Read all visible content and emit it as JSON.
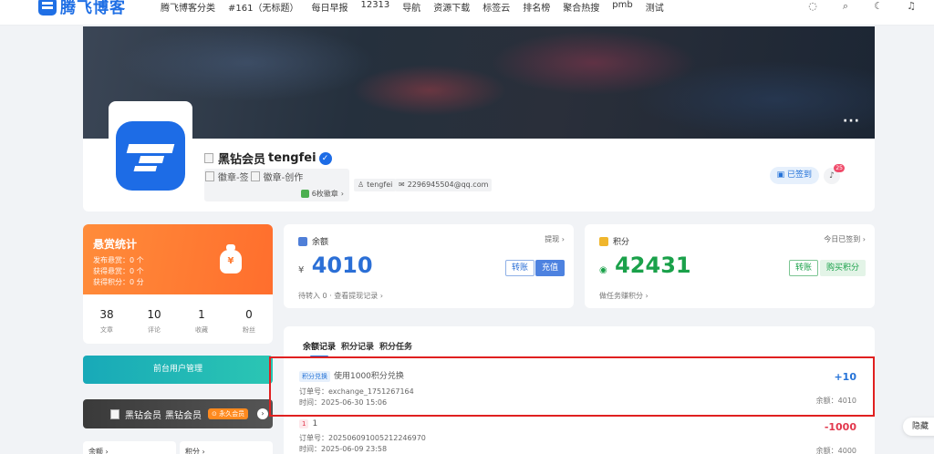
{
  "topbar": {
    "logo_text": "腾飞博客",
    "nav": [
      "腾飞博客分类",
      "#161（无标题）",
      "每日早报",
      "12313",
      "导航",
      "资源下载",
      "标签云",
      "排名榜",
      "聚合热搜",
      "pmb",
      "测试"
    ]
  },
  "profile": {
    "vip_label": "黑钻会员",
    "username": "tengfei",
    "badge_alt_1": "徽章-签",
    "badge_alt_2": "徽章-创作",
    "badge_count": "6枚徽章",
    "chip_user": "tengfei",
    "chip_email": "2296945504@qq.com",
    "checked_in": "已签到",
    "bell_count": "25"
  },
  "bounty": {
    "title": "悬赏统计",
    "line1": "发布悬赏：0 个",
    "line2": "获得悬赏：0 个",
    "line3": "获得积分：0 分",
    "bag_symbol": "¥"
  },
  "stats": [
    {
      "value": "38",
      "label": "文章"
    },
    {
      "value": "10",
      "label": "评论"
    },
    {
      "value": "1",
      "label": "收藏"
    },
    {
      "value": "0",
      "label": "粉丝"
    }
  ],
  "left": {
    "admin_button": "前台用户管理",
    "vip_card_label": "黑钻会员",
    "vip_card_text": "黑钻会员",
    "vip_tag": "永久会员",
    "mini_balance": "余额",
    "mini_points": "积分"
  },
  "balance_card": {
    "title": "余额",
    "link": "提现",
    "currency": "¥",
    "amount": "4010",
    "btn_transfer": "转账",
    "btn_recharge": "充值",
    "sub": "待转入 0 · 查看提现记录"
  },
  "points_card": {
    "title": "积分",
    "link": "今日已签到",
    "amount": "42431",
    "btn_transfer": "转账",
    "btn_buy": "购买积分",
    "sub": "做任务赚积分"
  },
  "records": {
    "tabs": [
      "余额记录",
      "积分记录",
      "积分任务"
    ],
    "items": [
      {
        "tag": "积分兑换",
        "desc": "使用1000积分兑换",
        "order": "订单号：exchange_1751267164",
        "time": "时间：2025-06-30 15:06",
        "amount": "+10",
        "balance": "余额：4010"
      },
      {
        "tag": "1",
        "desc": "1",
        "order": "订单号：202506091005212246970",
        "time": "时间：2025-06-09 23:58",
        "amount": "-1000",
        "balance": "余额：4000"
      }
    ]
  },
  "hide_tab": "隐藏",
  "colors": {
    "accent": "#2573d8",
    "balance_blue": "#2b6fd6",
    "points_green": "#1aa14a",
    "negative_red": "#e2384d",
    "bounty_orange": "#ff7a30"
  }
}
